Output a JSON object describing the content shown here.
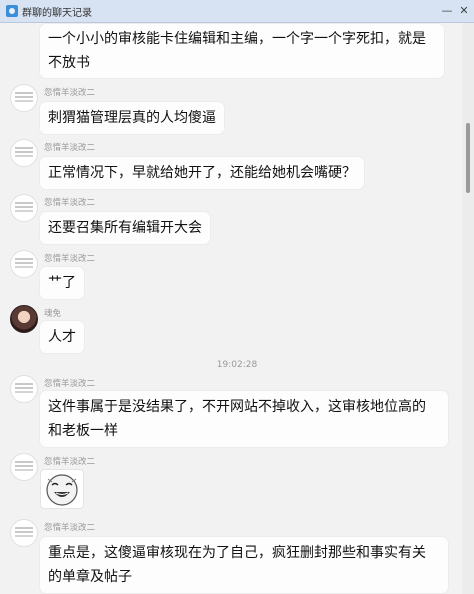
{
  "window": {
    "title": "群聊的聊天记录",
    "minimize": "—",
    "close": "✕"
  },
  "messages": [
    {
      "sender": "",
      "text_lines": [
        "一个小小的审核能卡住编辑和主编，一个字一个字死扣，就是",
        "不放书"
      ]
    },
    {
      "sender": "忽惰羊淡改二",
      "text": "刺猬猫管理层真的人均傻逼"
    },
    {
      "sender": "忽惰羊淡改二",
      "text": "正常情况下，早就给她开了，还能给她机会嘴硬？"
    },
    {
      "sender": "忽惰羊淡改二",
      "text": "还要召集所有编辑开大会"
    },
    {
      "sender": "忽惰羊淡改二",
      "text": "艹了"
    },
    {
      "sender": "魂免",
      "text": "人才"
    },
    {
      "timestamp": "19:02:28"
    },
    {
      "sender": "忽惰羊淡改二",
      "text_lines": [
        "这件事属于是没结果了，不开网站不掉收入，这审核地位高的",
        "和老板一样"
      ]
    },
    {
      "sender": "忽惰羊淡改二",
      "sticker": "laughing-face-sticker"
    },
    {
      "sender": "忽惰羊淡改二",
      "text_lines": [
        "重点是，这傻逼审核现在为了自己，疯狂删封那些和事实有关",
        "的单章及帖子"
      ]
    }
  ]
}
